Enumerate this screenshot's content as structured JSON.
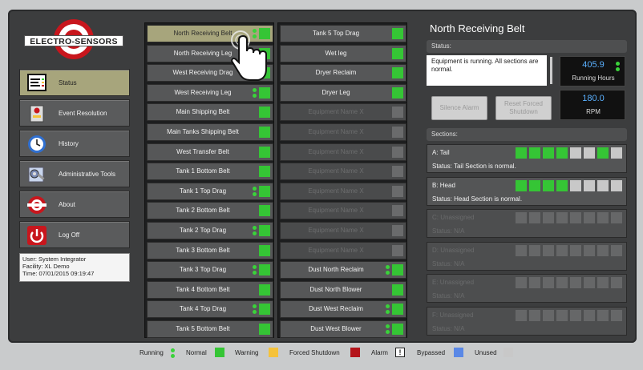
{
  "colors": {
    "running": "#3ad23a",
    "normal": "#35c535",
    "warning": "#f5c23a",
    "forced_shutdown": "#b4141a",
    "bypassed": "#5a88e6",
    "unused": "#c8c8c8",
    "selected": "#a7a57c",
    "readout_text": "#5ab0ff"
  },
  "logo": {
    "text": "ELECTRO-SENSORS"
  },
  "nav": [
    {
      "label": "Status",
      "icon": "monitor-icon",
      "active": true
    },
    {
      "label": "Event Resolution",
      "icon": "event-alarm-icon",
      "active": false
    },
    {
      "label": "History",
      "icon": "clock-icon",
      "active": false
    },
    {
      "label": "Administrative Tools",
      "icon": "tools-icon",
      "active": false
    },
    {
      "label": "About",
      "icon": "company-logo-icon",
      "active": false
    },
    {
      "label": "Log Off",
      "icon": "power-icon",
      "active": false
    }
  ],
  "user": {
    "line1": "User: System Integrator",
    "line2": "Facility: XL Demo",
    "line3": "Time: 07/01/2015 09:19:47"
  },
  "column1": [
    {
      "label": "North Receiving Belt",
      "running": true,
      "selected": true
    },
    {
      "label": "North Receiving Leg",
      "running": false
    },
    {
      "label": "West Receiving Drag",
      "running": false
    },
    {
      "label": "West Receiving Leg",
      "running": true
    },
    {
      "label": "Main Shipping Belt",
      "running": false
    },
    {
      "label": "Main Tanks Shipping Belt",
      "running": false
    },
    {
      "label": "West Transfer Belt",
      "running": false
    },
    {
      "label": "Tank 1 Bottom Belt",
      "running": false
    },
    {
      "label": "Tank 1 Top Drag",
      "running": true
    },
    {
      "label": "Tank 2 Bottom Belt",
      "running": false
    },
    {
      "label": "Tank 2 Top Drag",
      "running": true
    },
    {
      "label": "Tank 3 Bottom Belt",
      "running": false
    },
    {
      "label": "Tank 3 Top Drag",
      "running": true
    },
    {
      "label": "Tank 4 Bottom Belt",
      "running": false
    },
    {
      "label": "Tank 4 Top Drag",
      "running": true
    },
    {
      "label": "Tank 5 Bottom Belt",
      "running": false
    }
  ],
  "column2": [
    {
      "label": "Tank 5 Top Drag",
      "running": false,
      "used": true
    },
    {
      "label": "Wet leg",
      "running": false,
      "used": true
    },
    {
      "label": "Dryer Reclaim",
      "running": false,
      "used": true
    },
    {
      "label": "Dryer Leg",
      "running": false,
      "used": true
    },
    {
      "label": "Equipment Name X",
      "running": false,
      "used": false
    },
    {
      "label": "Equipment Name X",
      "running": false,
      "used": false
    },
    {
      "label": "Equipment Name X",
      "running": false,
      "used": false
    },
    {
      "label": "Equipment Name X",
      "running": false,
      "used": false
    },
    {
      "label": "Equipment Name X",
      "running": false,
      "used": false
    },
    {
      "label": "Equipment Name X",
      "running": false,
      "used": false
    },
    {
      "label": "Equipment Name X",
      "running": false,
      "used": false
    },
    {
      "label": "Equipment Name X",
      "running": false,
      "used": false
    },
    {
      "label": "Dust North Reclaim",
      "running": true,
      "used": true
    },
    {
      "label": "Dust North Blower",
      "running": false,
      "used": true
    },
    {
      "label": "Dust West Reclaim",
      "running": true,
      "used": true
    },
    {
      "label": "Dust West Blower",
      "running": true,
      "used": true
    }
  ],
  "panel": {
    "title": "North Receiving Belt",
    "status_label": "Status:",
    "status_text": "Equipment is running. All sections are normal.",
    "running_hours_value": "405.9",
    "running_hours_label": "Running Hours",
    "rpm_value": "180.0",
    "rpm_label": "RPM",
    "silence_alarm": "Silence Alarm",
    "reset_forced": "Reset Forced Shutdown",
    "sections_label": "Sections:"
  },
  "sections": [
    {
      "name": "A: Tail",
      "status": "Status: Tail Section is normal.",
      "used": true,
      "blocks": [
        "normal",
        "normal",
        "normal",
        "normal",
        "unused",
        "unused",
        "normal",
        "unused"
      ]
    },
    {
      "name": "B: Head",
      "status": "Status: Head Section is normal.",
      "used": true,
      "blocks": [
        "normal",
        "normal",
        "normal",
        "normal",
        "unused",
        "unused",
        "unused",
        "unused"
      ]
    },
    {
      "name": "C: Unassigned",
      "status": "Status: N/A",
      "used": false,
      "blocks": [
        "off",
        "off",
        "off",
        "off",
        "off",
        "off",
        "off",
        "off"
      ]
    },
    {
      "name": "D: Unassigned",
      "status": "Status: N/A",
      "used": false,
      "blocks": [
        "off",
        "off",
        "off",
        "off",
        "off",
        "off",
        "off",
        "off"
      ]
    },
    {
      "name": "E: Unassigned",
      "status": "Status: N/A",
      "used": false,
      "blocks": [
        "off",
        "off",
        "off",
        "off",
        "off",
        "off",
        "off",
        "off"
      ]
    },
    {
      "name": "F: Unassigned",
      "status": "Status: N/A",
      "used": false,
      "blocks": [
        "off",
        "off",
        "off",
        "off",
        "off",
        "off",
        "off",
        "off"
      ]
    }
  ],
  "legend": {
    "running": "Running",
    "normal": "Normal",
    "warning": "Warning",
    "forced_shutdown": "Forced Shutdown",
    "alarm": "Alarm",
    "alarm_symbol": "!",
    "bypassed": "Bypassed",
    "unused": "Unused"
  }
}
